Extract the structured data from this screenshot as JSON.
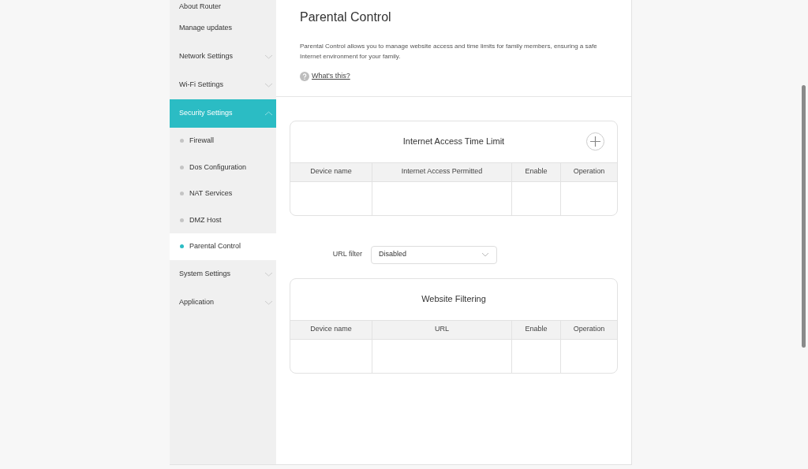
{
  "sidebar": {
    "items": [
      {
        "label": "About Router",
        "kind": "link",
        "selected": false
      },
      {
        "label": "Manage updates",
        "kind": "link",
        "selected": false
      },
      {
        "label": "Network Settings",
        "kind": "group",
        "expanded": false,
        "selected": false
      },
      {
        "label": "Wi-Fi Settings",
        "kind": "group",
        "expanded": false,
        "selected": false
      },
      {
        "label": "Security Settings",
        "kind": "group",
        "expanded": true,
        "selected": true,
        "children": [
          {
            "label": "Firewall",
            "selected": false
          },
          {
            "label": "Dos Configuration",
            "selected": false
          },
          {
            "label": "NAT Services",
            "selected": false
          },
          {
            "label": "DMZ Host",
            "selected": false
          },
          {
            "label": "Parental Control",
            "selected": true
          }
        ]
      },
      {
        "label": "System Settings",
        "kind": "group",
        "expanded": false,
        "selected": false
      },
      {
        "label": "Application",
        "kind": "group",
        "expanded": false,
        "selected": false
      }
    ]
  },
  "page": {
    "title": "Parental Control",
    "description": "Parental Control allows you to manage website access and time limits for family members, ensuring a safe Internet environment for your family.",
    "help_link": "What's this?"
  },
  "time_limit": {
    "title": "Internet Access Time Limit",
    "columns": [
      "Device name",
      "Internet Access Permitted",
      "Enable",
      "Operation"
    ]
  },
  "url_filter": {
    "label": "URL filter",
    "value": "Disabled"
  },
  "website_filtering": {
    "title": "Website Filtering",
    "columns": [
      "Device name",
      "URL",
      "Enable",
      "Operation"
    ]
  }
}
